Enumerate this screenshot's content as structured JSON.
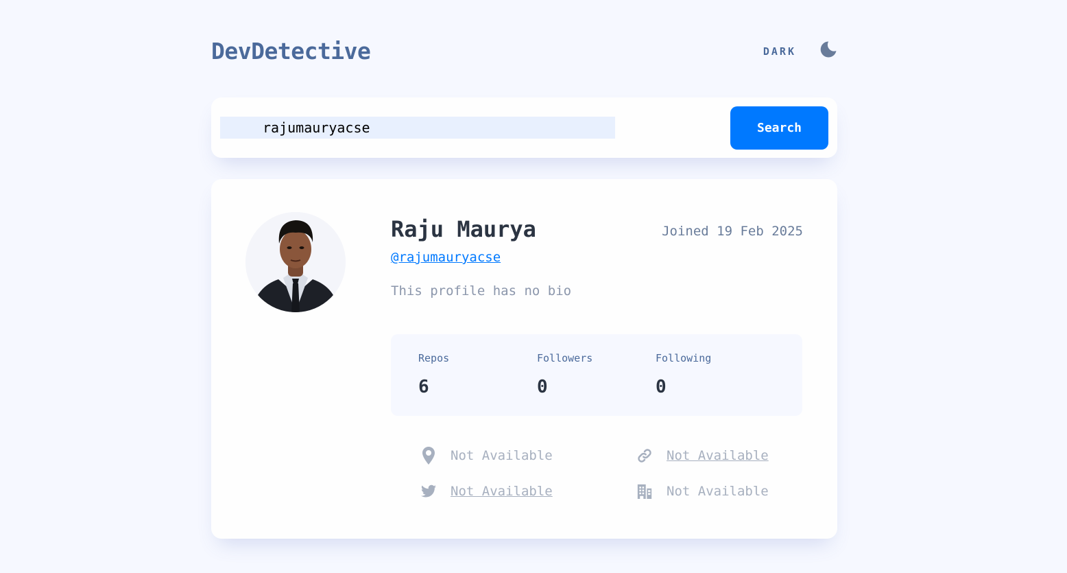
{
  "header": {
    "title": "DevDetective",
    "theme_label": "DARK",
    "theme_icon": "moon-icon"
  },
  "search": {
    "value": "rajumauryacse",
    "placeholder": "",
    "button_label": "Search"
  },
  "profile": {
    "name": "Raju Maurya",
    "joined": "Joined 19 Feb 2025",
    "login": "@rajumauryacse",
    "bio": "This profile has no bio",
    "stats": [
      {
        "label": "Repos",
        "value": "6"
      },
      {
        "label": "Followers",
        "value": "0"
      },
      {
        "label": "Following",
        "value": "0"
      }
    ],
    "links": {
      "location": {
        "text": "Not Available",
        "icon": "location-pin-icon"
      },
      "website": {
        "text": "Not Available",
        "icon": "link-icon"
      },
      "twitter": {
        "text": "Not Available",
        "icon": "twitter-icon"
      },
      "company": {
        "text": "Not Available",
        "icon": "building-icon"
      }
    }
  },
  "colors": {
    "background": "#f6f8ff",
    "card": "#fefefe",
    "accent": "#0079ff",
    "heading": "#2b3442",
    "muted": "#4b6a9b",
    "subtle": "#8b96ab",
    "input_bg": "#e8f0fe"
  }
}
